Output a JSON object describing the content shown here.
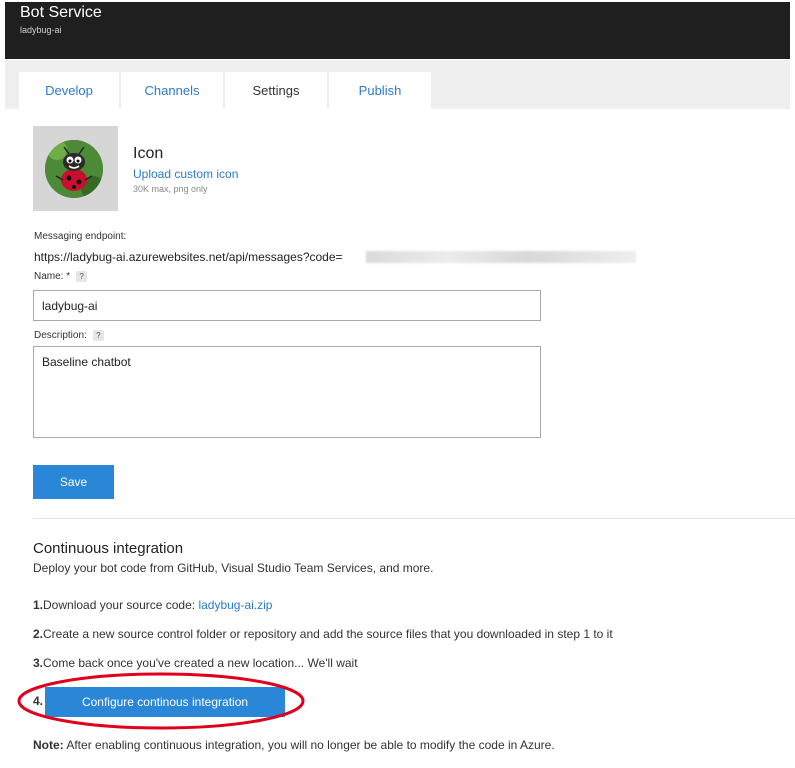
{
  "app": {
    "title": "Bot Service",
    "subtitle": "ladybug-ai"
  },
  "tabs": [
    {
      "label": "Develop",
      "active": false
    },
    {
      "label": "Channels",
      "active": false
    },
    {
      "label": "Settings",
      "active": true
    },
    {
      "label": "Publish",
      "active": false
    }
  ],
  "icon_section": {
    "title": "Icon",
    "upload_link": "Upload custom icon",
    "hint": "30K max, png only",
    "avatar_icon": "ladybug-avatar-icon"
  },
  "endpoint": {
    "label": "Messaging endpoint:",
    "value": "https://ladybug-ai.azurewebsites.net/api/messages?code="
  },
  "name_field": {
    "label": "Name: *",
    "help": "?",
    "value": "ladybug-ai"
  },
  "description_field": {
    "label": "Description:",
    "help": "?",
    "value": "Baseline chatbot"
  },
  "save_label": "Save",
  "ci": {
    "title": "Continuous integration",
    "description": "Deploy your bot code from GitHub, Visual Studio Team Services, and more.",
    "step1_num": "1.",
    "step1_text": "Download your source code: ",
    "step1_link": "ladybug-ai.zip",
    "step2_num": "2.",
    "step2_text": "Create a new source control folder or repository and add the source files that you downloaded in step 1 to it",
    "step3_num": "3.",
    "step3_text": "Come back once you've created a new location... We'll wait",
    "step4_num": "4.",
    "configure_label": "Configure continous integration",
    "note_label": "Note:",
    "note_text": " After enabling continuous integration, you will no longer be able to modify the code in Azure."
  },
  "colors": {
    "accent": "#2a86d6",
    "link": "#2b7bd0",
    "header": "#1f1f1f",
    "highlight": "#e0001b"
  }
}
